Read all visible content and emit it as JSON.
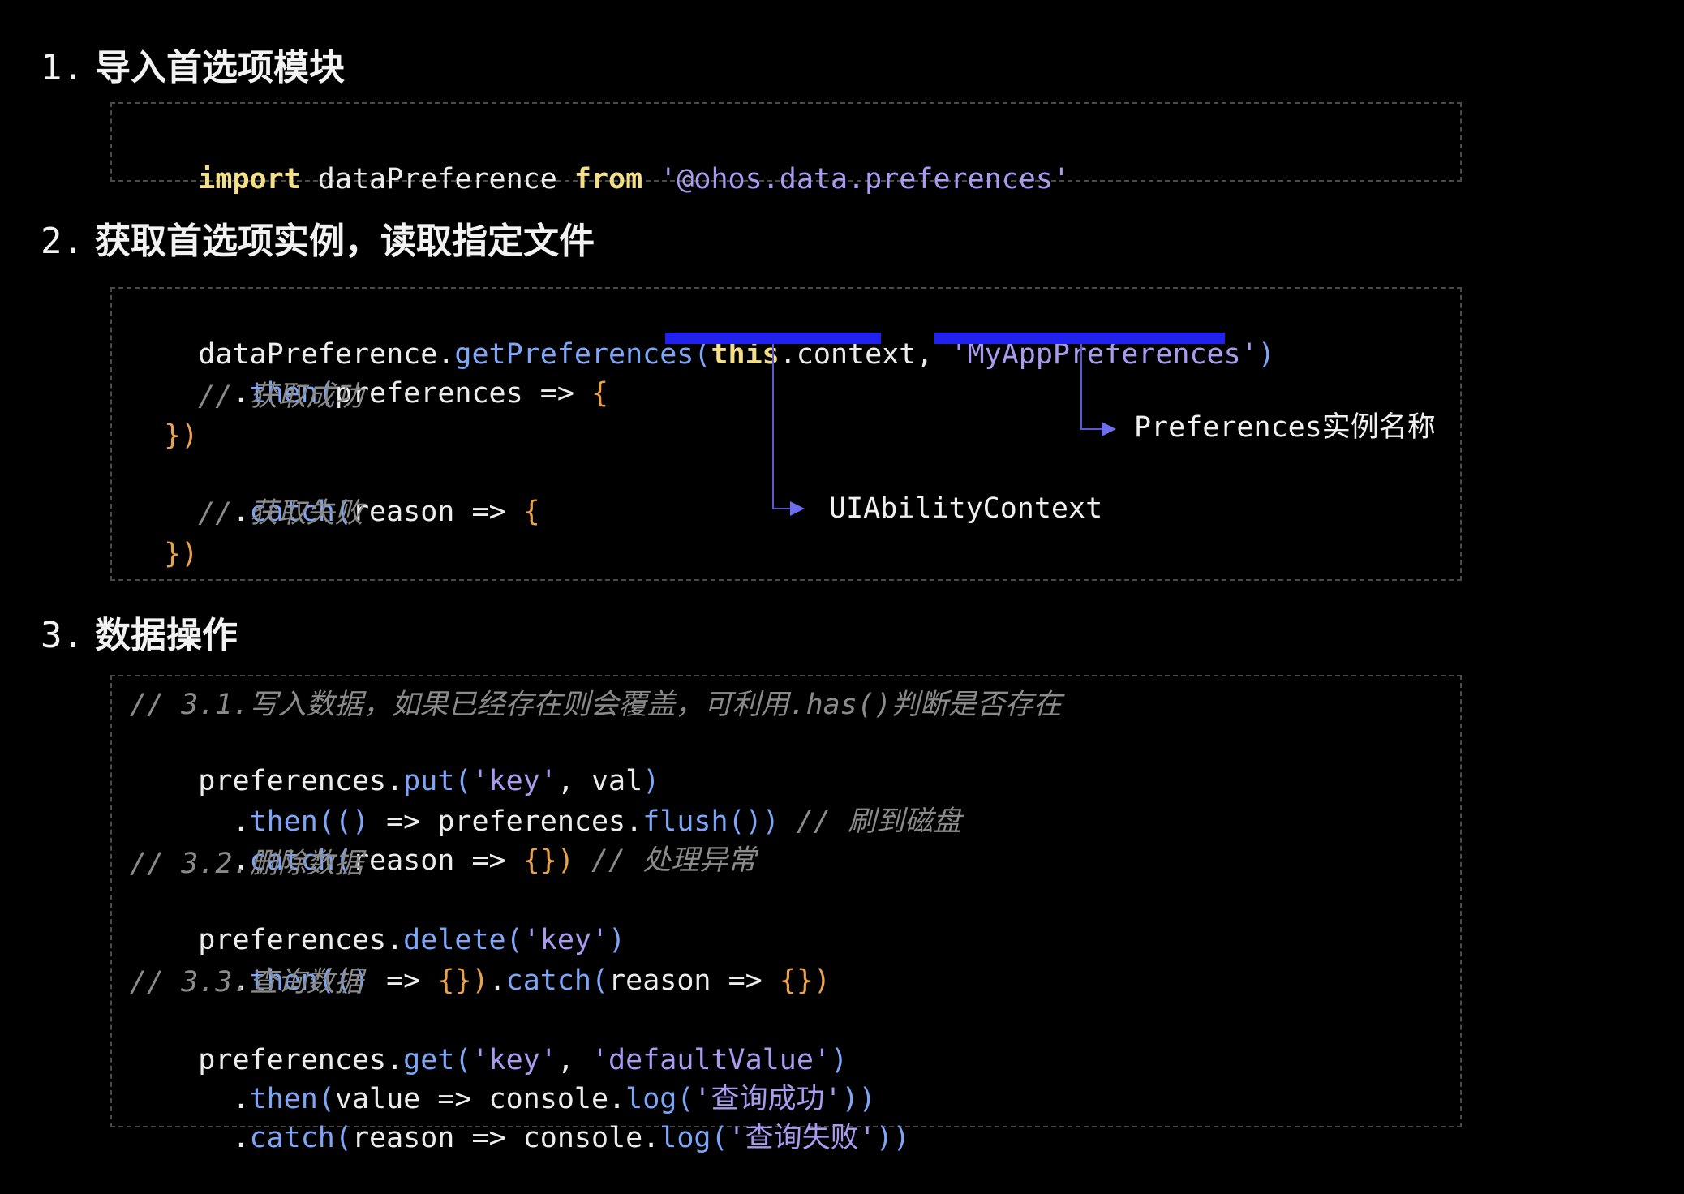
{
  "sections": [
    {
      "number": "1.",
      "title": "导入首选项模块"
    },
    {
      "number": "2.",
      "title": "获取首选项实例，读取指定文件"
    },
    {
      "number": "3.",
      "title": "数据操作"
    }
  ],
  "code1": {
    "import_kw": "import",
    "module_var": " dataPreference ",
    "from_kw": "from",
    "module_path": " '@ohos.data.preferences'"
  },
  "code2": {
    "l1_obj": "dataPreference.",
    "l1_fn": "getPreferences",
    "l1_paren": "(",
    "l1_this": "this",
    "l1_ctx": ".context, ",
    "l1_name": "'MyAppPreferences'",
    "l1_close": ")",
    "l2_dot": "  .",
    "l2_then": "then",
    "l2_paren": "(",
    "l2_args": "preferences => ",
    "l2_brace": "{",
    "l3_comment": "    // 获取成功",
    "l4_close": "  })",
    "l5_dot": "  .",
    "l5_catch": "catch",
    "l5_paren": "(",
    "l5_args": "reason => ",
    "l5_brace": "{",
    "l6_comment": "    // 获取失败",
    "l7_close": "  })"
  },
  "annotations": {
    "context_label": "UIAbilityContext",
    "name_label": "Preferences实例名称"
  },
  "code3": {
    "c1": "// 3.1.写入数据，如果已经存在则会覆盖，可利用.has()判断是否存在",
    "put_obj": "preferences.",
    "put_fn": "put",
    "put_open": "(",
    "put_key": "'key'",
    "put_rest": ", val",
    "put_close": ")",
    "then1_dot": "  .",
    "then1_fn": "then",
    "then1_open": "(() ",
    "then1_arrow": "=> preferences.",
    "then1_flush": "flush",
    "then1_close": "())",
    "then1_comment": " // 刷到磁盘",
    "catch1_dot": "  .",
    "catch1_fn": "catch",
    "catch1_open": "(",
    "catch1_args": "reason => ",
    "catch1_body": "{})",
    "catch1_comment": " // 处理异常",
    "c2": "// 3.2.删除数据",
    "del_obj": "preferences.",
    "del_fn": "delete",
    "del_open": "(",
    "del_key": "'key'",
    "del_close": ")",
    "then2_dot": "  .",
    "then2_fn": "then",
    "then2_open": "(() ",
    "then2_arrow": "=> ",
    "then2_body": "{})",
    "then2_dot2": ".",
    "then2_catch": "catch",
    "then2_open2": "(",
    "then2_args": "reason => ",
    "then2_body2": "{})",
    "c3": "// 3.3.查询数据",
    "get_obj": "preferences.",
    "get_fn": "get",
    "get_open": "(",
    "get_key": "'key'",
    "get_sep": ", ",
    "get_default": "'defaultValue'",
    "get_close": ")",
    "then3_dot": "  .",
    "then3_fn": "then",
    "then3_open": "(",
    "then3_args": "value => console.",
    "then3_log": "log",
    "then3_lopen": "(",
    "then3_msg": "'查询成功'",
    "then3_close": "))",
    "catch3_dot": "  .",
    "catch3_fn": "catch",
    "catch3_open": "(",
    "catch3_args": "reason => console.",
    "catch3_log": "log",
    "catch3_lopen": "(",
    "catch3_msg": "'查询失败'",
    "catch3_close": "))"
  },
  "colors": {
    "background": "#000000",
    "keyword": "#f3df8a",
    "string": "#a99cf0",
    "function": "#7ea6f7",
    "bracket": "#e7a24a",
    "comment": "#8a8a8a",
    "highlight": "#2222ee"
  }
}
